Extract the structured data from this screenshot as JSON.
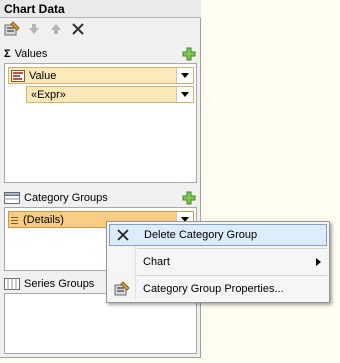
{
  "panel": {
    "title": "Chart Data"
  },
  "values": {
    "label": "Values",
    "items": [
      {
        "label": "Value"
      },
      {
        "label": "«Expr»"
      }
    ]
  },
  "category_groups": {
    "label": "Category Groups",
    "items": [
      {
        "label": "(Details)"
      }
    ]
  },
  "series_groups": {
    "label": "Series Groups"
  },
  "context_menu": {
    "items": [
      {
        "label": "Delete Category Group"
      },
      {
        "label": "Chart"
      },
      {
        "label": "Category Group Properties..."
      }
    ]
  }
}
